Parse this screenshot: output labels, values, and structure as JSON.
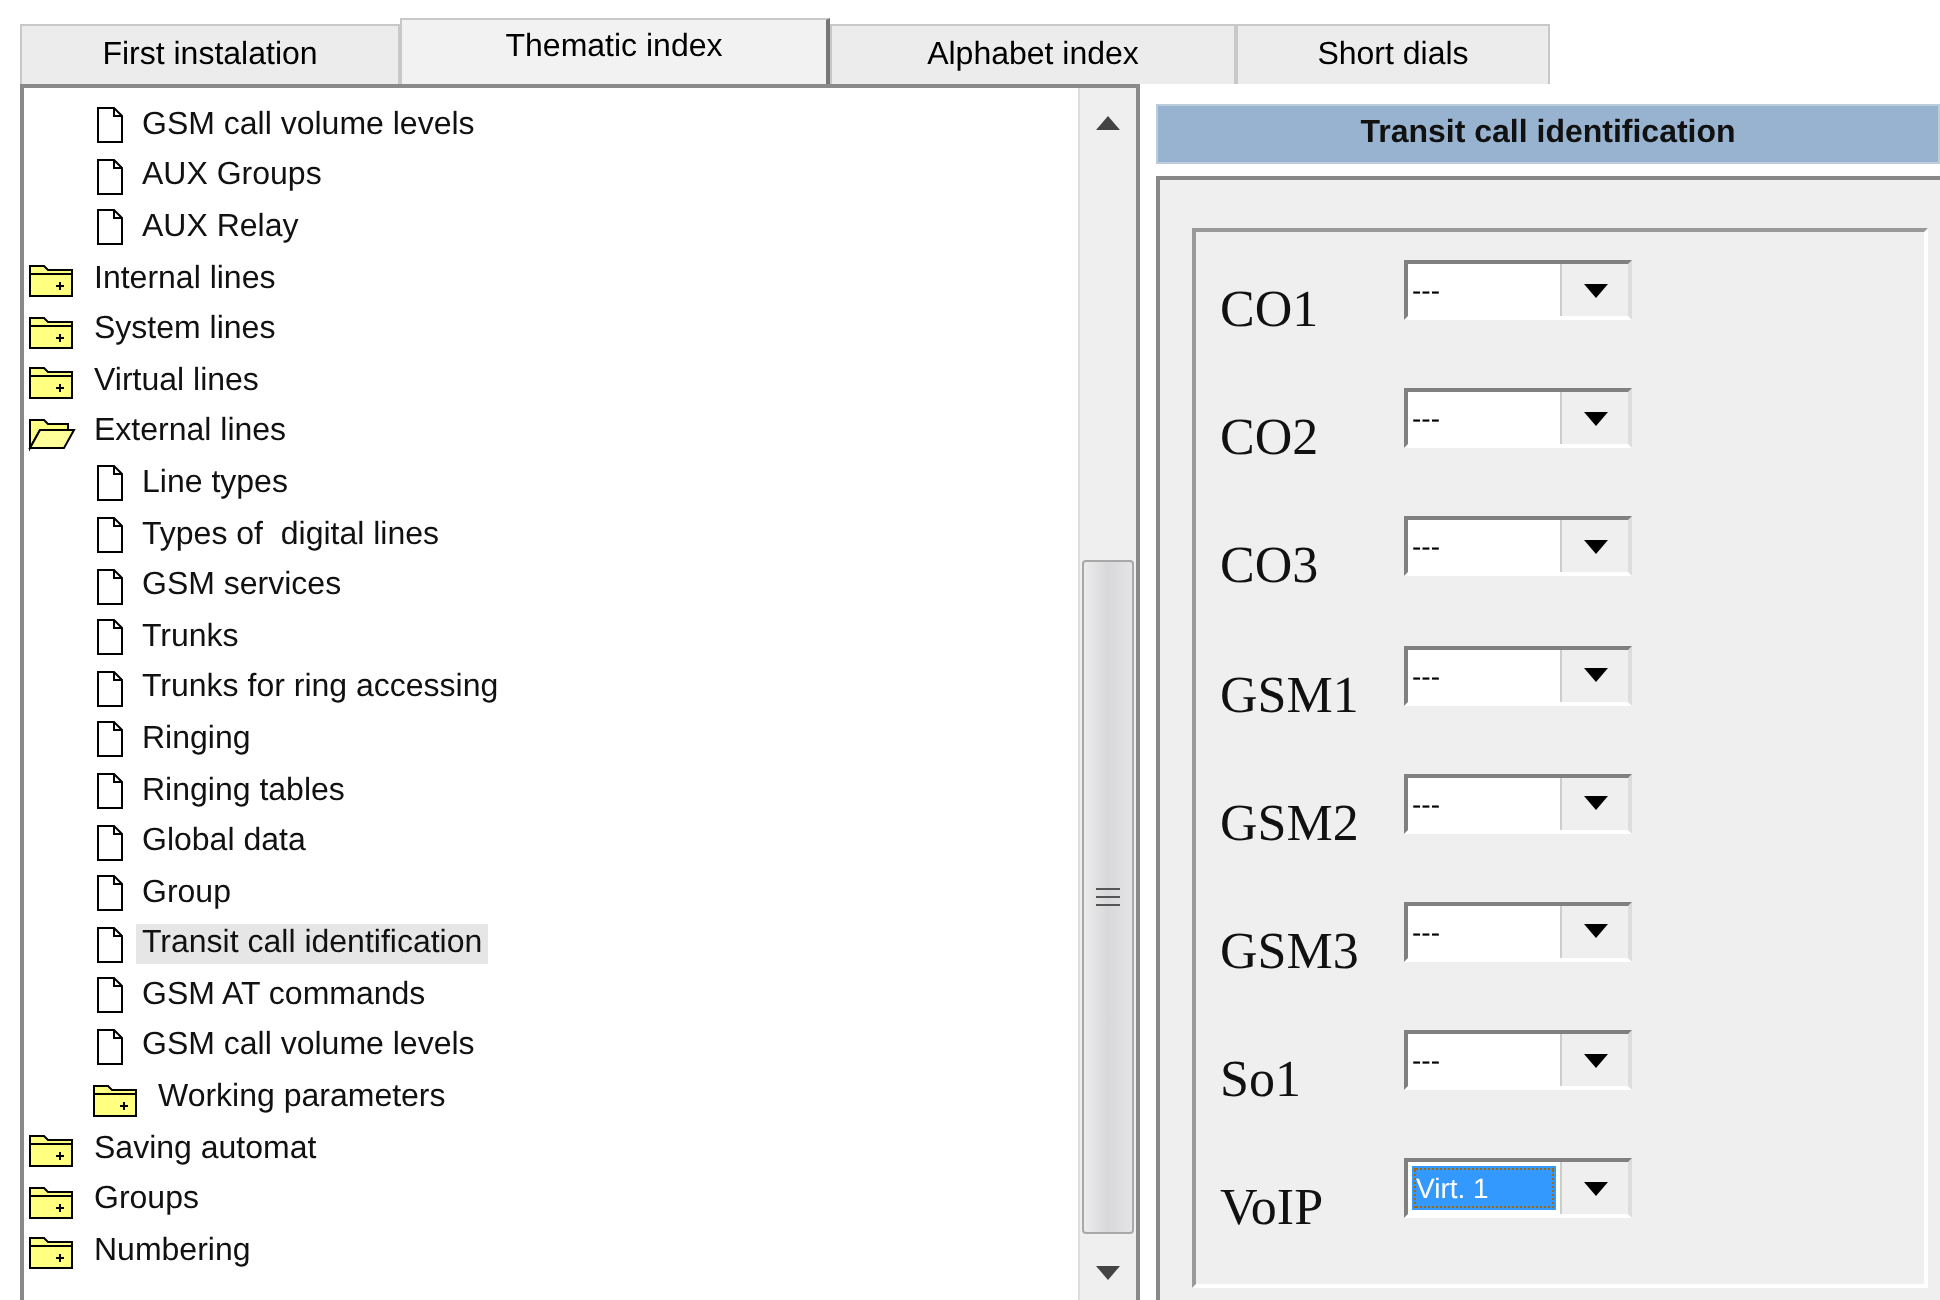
{
  "tabs": [
    {
      "label": "First instalation",
      "selected": false
    },
    {
      "label": "Thematic index",
      "selected": true
    },
    {
      "label": "Alphabet index",
      "selected": false
    },
    {
      "label": "Short dials",
      "selected": false
    }
  ],
  "tree": {
    "leading_items": [
      {
        "label": "GSM call volume levels",
        "kind": "page",
        "selected": false
      },
      {
        "label": "AUX Groups",
        "kind": "page",
        "selected": false
      },
      {
        "label": "AUX Relay",
        "kind": "page",
        "selected": false
      }
    ],
    "items": [
      {
        "label": "Internal lines",
        "kind": "folder",
        "expanded": false,
        "selected": false
      },
      {
        "label": "System lines",
        "kind": "folder",
        "expanded": false,
        "selected": false
      },
      {
        "label": "Virtual lines",
        "kind": "folder",
        "expanded": false,
        "selected": false
      },
      {
        "label": "External lines",
        "kind": "folder",
        "expanded": true,
        "selected": false,
        "children": [
          {
            "label": "Line types",
            "kind": "page",
            "selected": false
          },
          {
            "label": "Types of  digital lines",
            "kind": "page",
            "selected": false
          },
          {
            "label": "GSM services",
            "kind": "page",
            "selected": false
          },
          {
            "label": "Trunks",
            "kind": "page",
            "selected": false
          },
          {
            "label": "Trunks for ring accessing",
            "kind": "page",
            "selected": false
          },
          {
            "label": "Ringing",
            "kind": "page",
            "selected": false
          },
          {
            "label": "Ringing tables",
            "kind": "page",
            "selected": false
          },
          {
            "label": "Global data",
            "kind": "page",
            "selected": false
          },
          {
            "label": "Group",
            "kind": "page",
            "selected": false
          },
          {
            "label": "Transit call identification",
            "kind": "page",
            "selected": true
          },
          {
            "label": "GSM AT commands",
            "kind": "page",
            "selected": false
          },
          {
            "label": "GSM call volume levels",
            "kind": "page",
            "selected": false
          },
          {
            "label": "Working parameters",
            "kind": "folder",
            "expanded": false,
            "selected": false
          }
        ]
      },
      {
        "label": "Saving automat",
        "kind": "folder",
        "expanded": false,
        "selected": false
      },
      {
        "label": "Groups",
        "kind": "folder",
        "expanded": false,
        "selected": false
      },
      {
        "label": "Numbering",
        "kind": "folder",
        "expanded": false,
        "selected": false
      }
    ]
  },
  "panel": {
    "title": "Transit call identification",
    "fields": [
      {
        "label": "CO1",
        "value": "---",
        "focused": false
      },
      {
        "label": "CO2",
        "value": "---",
        "focused": false
      },
      {
        "label": "CO3",
        "value": "---",
        "focused": false
      },
      {
        "label": "GSM1",
        "value": "---",
        "focused": false
      },
      {
        "label": "GSM2",
        "value": "---",
        "focused": false
      },
      {
        "label": "GSM3",
        "value": "---",
        "focused": false
      },
      {
        "label": "So1",
        "value": "---",
        "focused": false
      },
      {
        "label": "VoIP",
        "value": "Virt. 1",
        "focused": true
      }
    ]
  }
}
